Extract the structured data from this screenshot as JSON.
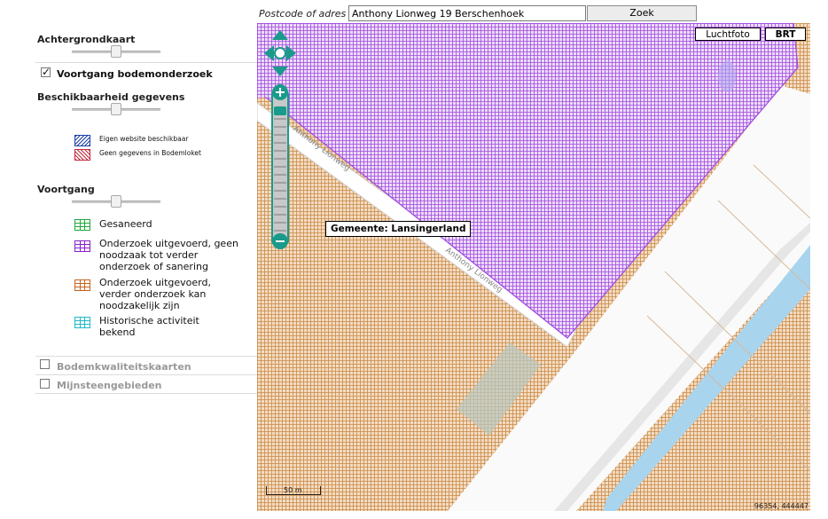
{
  "panel": {
    "background_map": {
      "title": "Achtergrondkaart"
    },
    "progress_layer": {
      "label": "Voortgang bodemonderzoek",
      "checked": true
    },
    "availability": {
      "title": "Beschikbaarheid gegevens",
      "legend": [
        {
          "label": "Eigen website beschikbaar",
          "color": "#1c3fa8"
        },
        {
          "label": "Geen gegevens in Bodemloket",
          "color": "#c0283a"
        }
      ]
    },
    "progress": {
      "title": "Voortgang",
      "legend": [
        {
          "label": "Gesaneerd",
          "color": "#1ea83a"
        },
        {
          "label": "Onderzoek uitgevoerd, geen noodzaak tot verder onderzoek of sanering",
          "color": "#8a1fc8"
        },
        {
          "label": "Onderzoek uitgevoerd, verder onderzoek kan noodzakelijk zijn",
          "color": "#c8621e"
        },
        {
          "label": "Historische activiteit bekend",
          "color": "#1fb8c8"
        }
      ]
    },
    "collapsed_layers": [
      {
        "label": "Bodemkwaliteitskaarten",
        "checked": false
      },
      {
        "label": "Mijnsteengebieden",
        "checked": false
      }
    ]
  },
  "search": {
    "label": "Postcode of adres",
    "value": "Anthony Lionweg 19 Berschenhoek",
    "button": "Zoek"
  },
  "map": {
    "layers": {
      "aerial": "Luchtfoto",
      "brt": "BRT",
      "active": "BRT"
    },
    "tooltip": "Gemeente: Lansingerland",
    "street_labels": [
      "Anthony Lionweg",
      "Anthony Lionweg"
    ],
    "scale": "50 m",
    "coordinates": "96354, 444447",
    "controls": {
      "pan_icon": "pan-arrows-icon",
      "zoom_in_icon": "plus-icon",
      "zoom_out_icon": "minus-icon",
      "zoom_slider_icon": "zoom-bar-icon",
      "color": "#1a9a8a"
    },
    "fill_colors": {
      "purple": "#a04ae0",
      "orange": "#c88a48",
      "road": "#ffffff",
      "water": "#a8d4ee"
    }
  }
}
